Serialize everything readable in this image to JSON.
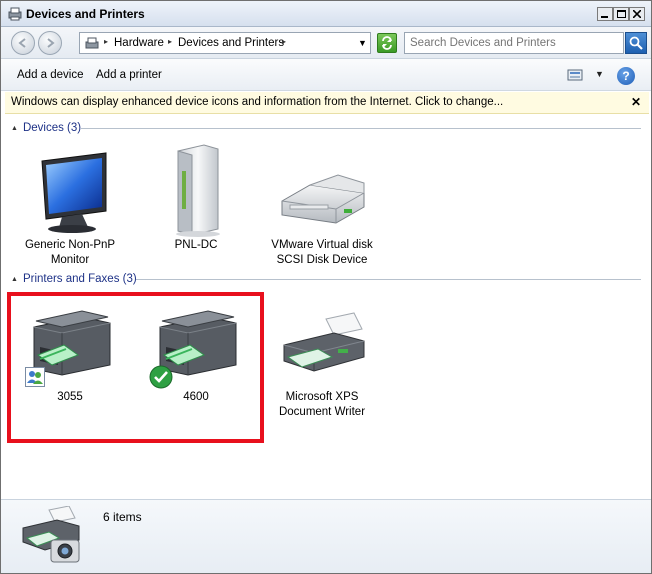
{
  "window": {
    "title": "Devices and Printers",
    "min_label": "0",
    "max_label": "1",
    "close_label": "r"
  },
  "address": {
    "crumbs": [
      "Hardware",
      "Devices and Printers"
    ],
    "search_placeholder": "Search Devices and Printers"
  },
  "toolbar": {
    "add_device": "Add a device",
    "add_printer": "Add a printer"
  },
  "infobar": {
    "text": "Windows can display enhanced device icons and information from the Internet. Click to change...",
    "close": "✕"
  },
  "groups": [
    {
      "label": "Devices (3)",
      "items": [
        {
          "line1": "Generic Non-PnP",
          "line2": "Monitor",
          "icon": "monitor-icon"
        },
        {
          "line1": "PNL-DC",
          "line2": "",
          "icon": "computer-tower-icon"
        },
        {
          "line1": "VMware Virtual disk",
          "line2": "SCSI Disk Device",
          "icon": "hard-disk-icon"
        }
      ]
    },
    {
      "label": "Printers and Faxes (3)",
      "items": [
        {
          "line1": "3055",
          "line2": "",
          "icon": "multifunction-printer-icon",
          "badge": "shared-users-icon"
        },
        {
          "line1": "4600",
          "line2": "",
          "icon": "multifunction-printer-icon",
          "badge": "default-check-icon"
        },
        {
          "line1": "Microsoft XPS",
          "line2": "Document Writer",
          "icon": "printer-icon"
        }
      ]
    }
  ],
  "details": {
    "count": "6 items"
  },
  "colors": {
    "highlight": "#e8101d",
    "group_label": "#1e3287",
    "infobar_bg": "#fffbe1"
  }
}
